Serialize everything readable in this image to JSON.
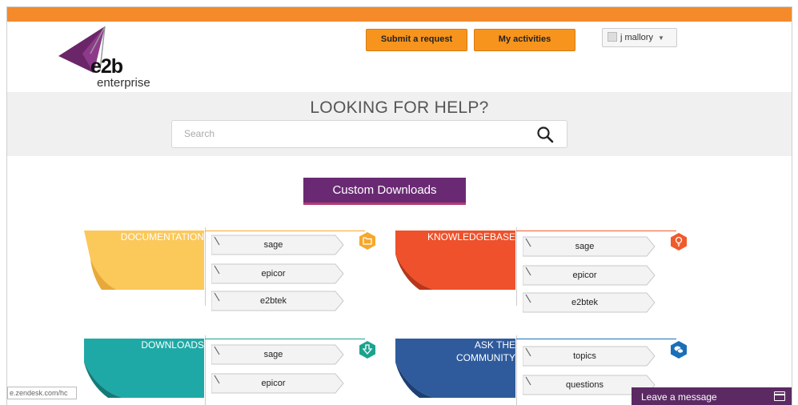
{
  "logo": {
    "brand": "e2b",
    "sub": "enterprise"
  },
  "header": {
    "submit_request": "Submit a request",
    "my_activities": "My activities",
    "user_name": "j  mallory"
  },
  "hero": {
    "title": "LOOKING FOR HELP?",
    "search_placeholder": "Search"
  },
  "custom_downloads": "Custom Downloads",
  "cards": {
    "documentation": {
      "label": "DOCUMENTATION",
      "items": [
        "sage",
        "epicor",
        "e2btek"
      ],
      "color": "#fbc85a",
      "badge_color": "#f7a72c",
      "badge_icon": "folder-icon"
    },
    "knowledgebase": {
      "label": "KNOWLEDGEBASE",
      "items": [
        "sage",
        "epicor",
        "e2btek"
      ],
      "color": "#ee512b",
      "badge_color": "#ef5b2c",
      "badge_icon": "lightbulb-icon"
    },
    "downloads": {
      "label": "DOWNLOADS",
      "items": [
        "sage",
        "epicor"
      ],
      "color": "#1fa9a6",
      "badge_color": "#1aa38f",
      "badge_icon": "download-icon"
    },
    "community": {
      "label_line1": "ASK THE",
      "label_line2": "COMMUNITY",
      "items": [
        "topics",
        "questions"
      ],
      "color": "#2f5b9c",
      "badge_color": "#1a6fb8",
      "badge_icon": "chat-icon"
    }
  },
  "footer": {
    "url_hint": "e.zendesk.com/hc",
    "leave_message": "Leave a message"
  }
}
